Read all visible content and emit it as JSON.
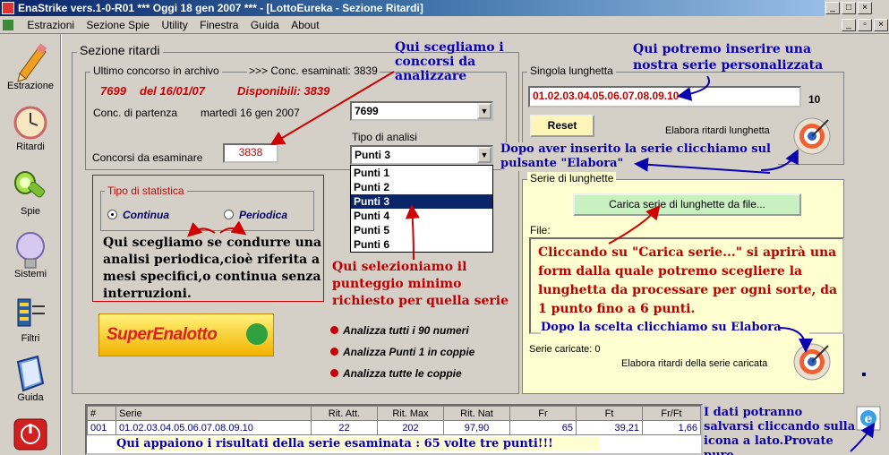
{
  "window": {
    "title": "EnaStrike vers.1-0-R01  ***  Oggi 18 gen 2007  ***   - [LottoEureka - Sezione Ritardi]"
  },
  "menu": [
    "Estrazioni",
    "Sezione Spie",
    "Utility",
    "Finestra",
    "Guida",
    "About"
  ],
  "sidebar": [
    {
      "label": "Estrazione",
      "icon": "pencil-icon"
    },
    {
      "label": "Ritardi",
      "icon": "clock-icon"
    },
    {
      "label": "Spie",
      "icon": "flashlight-icon"
    },
    {
      "label": "Sistemi",
      "icon": "lightbulb-icon"
    },
    {
      "label": "Filtri",
      "icon": "filter-icon"
    },
    {
      "label": "Guida",
      "icon": "book-icon"
    },
    {
      "label": "",
      "icon": "power-icon"
    }
  ],
  "section": {
    "title": "Sezione ritardi",
    "archive_label": "Ultimo concorso in archivo",
    "examined_label": ">>> Conc. esaminati: 3839",
    "last_draw": "7699",
    "last_draw_date": "del 16/01/07",
    "available": "Disponibili: 3839",
    "start_label": "Conc. di partenza",
    "start_date": "martedì 16 gen 2007",
    "start_value": "7699",
    "examine_label": "Concorsi da esaminare",
    "examine_value": "3838",
    "analysis_label": "Tipo di analisi",
    "analysis_selected": "Punti 3",
    "analysis_options": [
      "Punti 1",
      "Punti 2",
      "Punti 3",
      "Punti 4",
      "Punti 5",
      "Punti 6"
    ],
    "stat_legend": "Tipo di statistica",
    "stat_continua": "Continua",
    "stat_periodica": "Periodica",
    "logo_text": "SuperEnalotto",
    "links": [
      "Analizza tutti i 90 numeri",
      "Analizza Punti 1 in coppie",
      "Analizza tutte le coppie"
    ]
  },
  "single": {
    "legend": "Singola lunghetta",
    "value": "01.02.03.04.05.06.07.08.09.10",
    "count": "10",
    "reset": "Reset",
    "elabora": "Elabora ritardi lunghetta"
  },
  "series": {
    "legend": "Serie di lunghette",
    "load_button": "Carica serie di lunghette da file...",
    "file_label": "File:",
    "loaded_label": "Serie caricate: 0",
    "elabora": "Elabora ritardi della serie caricata"
  },
  "table": {
    "headers": [
      "#",
      "Serie",
      "Rit. Att.",
      "Rit. Max",
      "Rit. Nat",
      "Fr",
      "Ft",
      "Fr/Ft"
    ],
    "rows": [
      [
        "001",
        "01.02.03.04.05.06.07.08.09.10",
        "22",
        "202",
        "97,90",
        "65",
        "39,21",
        "1,66"
      ]
    ]
  },
  "annotations": {
    "a1": "Qui scegliamo i concorsi da analizzare",
    "a2": "Qui potremo inserire una nostra serie personalizzata",
    "a3": "Dopo aver inserito la serie clicchiamo sul pulsante \"Elabora\"",
    "a4": "Qui scegliamo se condurre una analisi periodica,cioè riferita a mesi specifici,o continua senza interruzioni.",
    "a5": "Qui selezioniamo il punteggio minimo richiesto per quella serie",
    "a6": "Cliccando su \"Carica serie...\" si aprirà una form dalla quale potremo scegliere la lunghetta da processare per ogni sorte, da 1 punto fino a 6 punti.",
    "a7": "Dopo la scelta clicchiamo su Elabora",
    "a8": "I dati potranno salvarsi cliccando sulla icona a lato.Provate pure",
    "a9": "Qui appaiono i risultati della serie esaminata : 65 volte tre punti!!!"
  }
}
